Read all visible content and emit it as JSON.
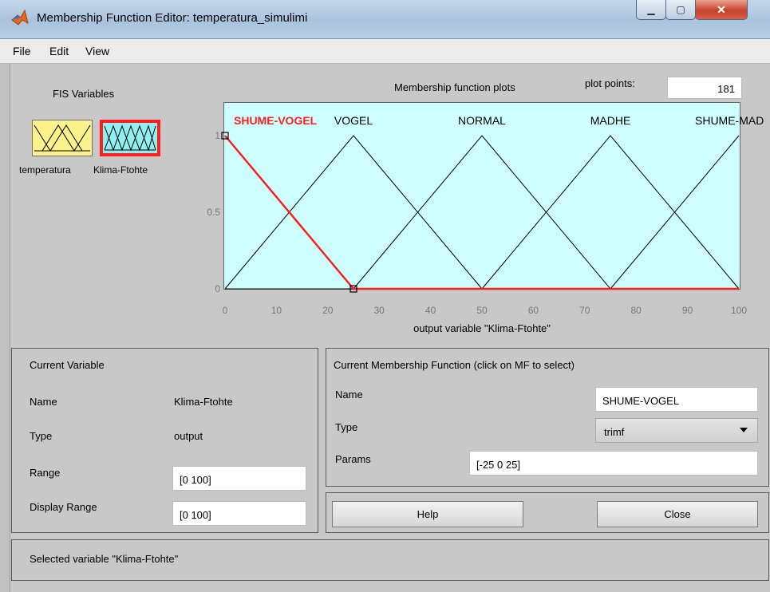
{
  "window": {
    "title": "Membership Function Editor: temperatura_simulimi",
    "min_glyph": "▁",
    "max_glyph": "▢",
    "close_glyph": "✕"
  },
  "menu": [
    {
      "label": "File"
    },
    {
      "label": "Edit"
    },
    {
      "label": "View"
    }
  ],
  "fis": {
    "title": "FIS Variables",
    "input_name": "temperatura",
    "output_name": "Klima-Ftohte",
    "input_color": "#fbf28c",
    "output_color": "#8ef0f0",
    "selected_color": "#ff1d1d"
  },
  "plot": {
    "heading": "Membership function plots",
    "plot_points_label": "plot points:",
    "plot_points_value": "181",
    "xlabel": "output variable \"Klima-Ftohte\""
  },
  "chart_data": {
    "type": "line",
    "xlim": [
      0,
      100
    ],
    "ylim": [
      0,
      1
    ],
    "x_ticks": [
      0,
      10,
      20,
      30,
      40,
      50,
      60,
      70,
      80,
      90,
      100
    ],
    "y_ticks": [
      0,
      0.5,
      1
    ],
    "xlabel": "output variable \"Klima-Ftohte\"",
    "background": "#ceffff",
    "series": [
      {
        "name": "SHUME-VOGEL",
        "x": [
          0,
          25,
          100
        ],
        "y": [
          1,
          0,
          0
        ],
        "selected": true,
        "color": "#ff1d1d",
        "label_x": 25
      },
      {
        "name": "VOGEL",
        "x": [
          0,
          25,
          50
        ],
        "y": [
          0,
          1,
          0
        ],
        "selected": false,
        "color": "#000000",
        "label_x": 25
      },
      {
        "name": "NORMAL",
        "x": [
          25,
          50,
          75
        ],
        "y": [
          0,
          1,
          0
        ],
        "selected": false,
        "color": "#000000",
        "label_x": 50
      },
      {
        "name": "MADHE",
        "x": [
          50,
          75,
          100
        ],
        "y": [
          0,
          1,
          0
        ],
        "selected": false,
        "color": "#000000",
        "label_x": 75
      },
      {
        "name": "SHUME-MADHE",
        "display": "SHUME-MAD",
        "x": [
          75,
          100
        ],
        "y": [
          0,
          1
        ],
        "selected": false,
        "color": "#000000",
        "label_x": 100
      }
    ]
  },
  "current_variable": {
    "title": "Current Variable",
    "name_label": "Name",
    "name_value": "Klima-Ftohte",
    "type_label": "Type",
    "type_value": "output",
    "range_label": "Range",
    "range_value": "[0 100]",
    "display_range_label": "Display Range",
    "display_range_value": "[0 100]"
  },
  "current_mf": {
    "title": "Current Membership Function (click on MF to select)",
    "name_label": "Name",
    "name_value": "SHUME-VOGEL",
    "type_label": "Type",
    "type_value": "trimf",
    "params_label": "Params",
    "params_value": "[-25 0 25]"
  },
  "buttons": {
    "help": "Help",
    "close": "Close"
  },
  "status": "Selected variable \"Klima-Ftohte\""
}
